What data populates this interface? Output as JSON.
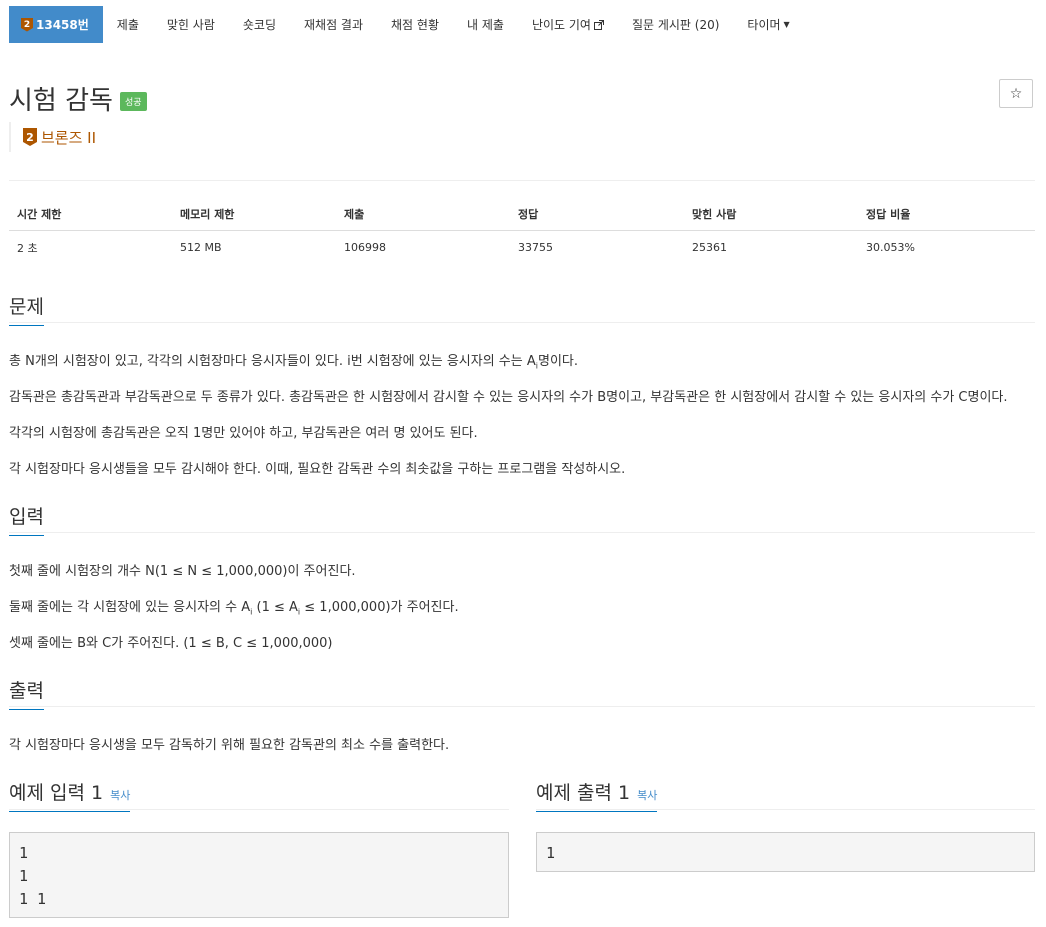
{
  "nav": {
    "problem_tier": "2",
    "problem_label": "13458번",
    "submit": "제출",
    "solved_users": "맞힌 사람",
    "shortcoding": "숏코딩",
    "rejudge": "재채점 결과",
    "status": "채점 현황",
    "my_submissions": "내 제출",
    "difficulty_contrib": "난이도 기여",
    "board": "질문 게시판 (20)",
    "timer": "타이머"
  },
  "problem": {
    "title": "시험 감독",
    "result_badge": "성공",
    "star_symbol": "☆",
    "tier_number": "2",
    "tier_label": "브론즈 II",
    "tier_color": "#ad5600"
  },
  "info": {
    "headers": [
      "시간 제한",
      "메모리 제한",
      "제출",
      "정답",
      "맞힌 사람",
      "정답 비율"
    ],
    "values": [
      "2 초",
      "512 MB",
      "106998",
      "33755",
      "25361",
      "30.053%"
    ]
  },
  "sections": {
    "description_title": "문제",
    "description": {
      "p1_pre": "총 N개의 시험장이 있고, 각각의 시험장마다 응시자들이 있다. i번 시험장에 있는 응시자의 수는 A",
      "p1_sub": "i",
      "p1_post": "명이다.",
      "p2": "감독관은 총감독관과 부감독관으로 두 종류가 있다. 총감독관은 한 시험장에서 감시할 수 있는 응시자의 수가 B명이고, 부감독관은 한 시험장에서 감시할 수 있는 응시자의 수가 C명이다.",
      "p3": "각각의 시험장에 총감독관은 오직 1명만 있어야 하고, 부감독관은 여러 명 있어도 된다.",
      "p4": "각 시험장마다 응시생들을 모두 감시해야 한다. 이때, 필요한 감독관 수의 최솟값을 구하는 프로그램을 작성하시오."
    },
    "input_title": "입력",
    "input": {
      "p1": "첫째 줄에 시험장의 개수 N(1 ≤ N ≤ 1,000,000)이 주어진다.",
      "p2_pre": "둘째 줄에는 각 시험장에 있는 응시자의 수 A",
      "p2_sub1": "i",
      "p2_mid": " (1 ≤ A",
      "p2_sub2": "i",
      "p2_post": " ≤ 1,000,000)가 주어진다.",
      "p3": "셋째 줄에는 B와 C가 주어진다. (1 ≤ B, C ≤ 1,000,000)"
    },
    "output_title": "출력",
    "output": {
      "p1": "각 시험장마다 응시생을 모두 감독하기 위해 필요한 감독관의 최소 수를 출력한다."
    }
  },
  "samples": {
    "input_title": "예제 입력 1",
    "output_title": "예제 출력 1",
    "copy_label": "복사",
    "input_text": "1\n1\n1 1",
    "output_text": "1"
  }
}
